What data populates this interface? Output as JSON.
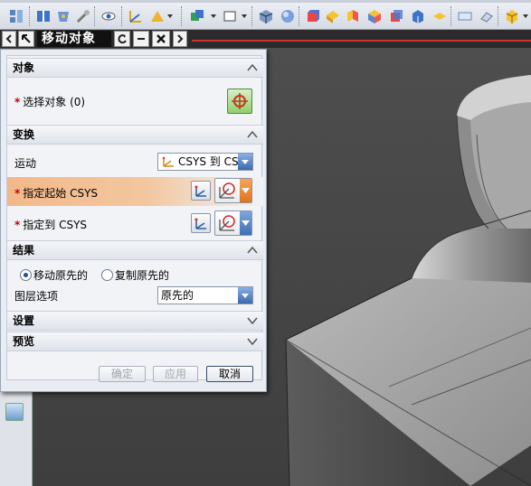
{
  "window": {
    "title": "移动对象"
  },
  "dialog": {
    "sections": {
      "object": {
        "label": "对象",
        "select_label": "选择对象 (0)",
        "required_mark": "*"
      },
      "transform": {
        "label": "变换",
        "motion_label": "运动",
        "motion_value": "CSYS 到 CSYS",
        "specify_start_label": "指定起始 CSYS",
        "specify_to_label": "指定到 CSYS",
        "required_mark": "*"
      },
      "result": {
        "label": "结果",
        "option_move": "移动原先的",
        "option_copy": "复制原先的",
        "selected": "移动原先的",
        "layer_label": "图层选项",
        "layer_value": "原先的"
      },
      "settings": {
        "label": "设置"
      },
      "preview": {
        "label": "预览"
      }
    },
    "buttons": {
      "ok": "确定",
      "apply": "应用",
      "cancel": "取消"
    }
  },
  "colors": {
    "accent": "#f3b889",
    "viewport": "#4a4a4a",
    "red_line": "#cc3333"
  },
  "icons": [
    "select-object-icon",
    "csys-icon",
    "csys-dropdown-icon",
    "toolbar-icons",
    "resource-bar-icon"
  ]
}
